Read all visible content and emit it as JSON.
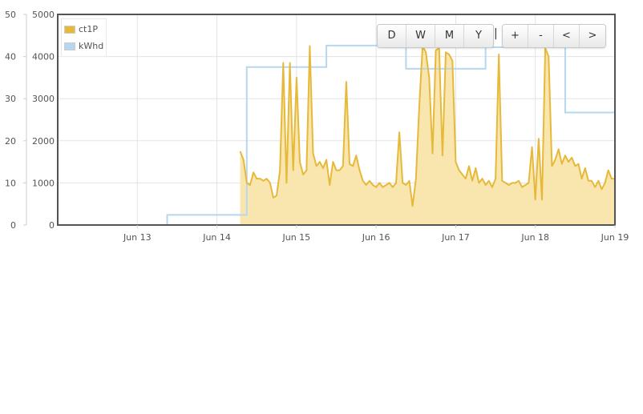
{
  "colors": {
    "ct1p_line": "#e7b93a",
    "ct1p_fill": "#f8e6ae",
    "kwhd_line": "#b5d8f0",
    "frame": "#545454",
    "grid": "#e3e3e3"
  },
  "controls": {
    "range_buttons": [
      "D",
      "W",
      "M",
      "Y"
    ],
    "separator": "|",
    "zoom_buttons": [
      "+",
      "-",
      "<",
      ">"
    ]
  },
  "chart_data": {
    "type": "area",
    "xlim": [
      "2024-06-12T00:00",
      "2024-06-19T00:00"
    ],
    "x_ticks": [
      "Jun 13",
      "Jun 14",
      "Jun 15",
      "Jun 16",
      "Jun 17",
      "Jun 18",
      "Jun 19"
    ],
    "y_left": {
      "ylim": [
        0,
        50
      ],
      "ticks": [
        "0",
        "10",
        "20",
        "30",
        "40",
        "50"
      ]
    },
    "y_right": {
      "ylim": [
        0,
        5000
      ],
      "ticks": [
        "0",
        "1000",
        "2000",
        "3000",
        "4000",
        "5000"
      ]
    },
    "grid": true,
    "legend": "top-left",
    "series": [
      {
        "name": "ct1P",
        "axis": "right",
        "style": "line-fill",
        "points": [
          [
            "2024-06-14T07:00",
            1750
          ],
          [
            "2024-06-14T08:00",
            1550
          ],
          [
            "2024-06-14T09:00",
            1000
          ],
          [
            "2024-06-14T10:00",
            950
          ],
          [
            "2024-06-14T11:00",
            1250
          ],
          [
            "2024-06-14T12:00",
            1100
          ],
          [
            "2024-06-14T13:00",
            1100
          ],
          [
            "2024-06-14T14:00",
            1050
          ],
          [
            "2024-06-14T15:00",
            1100
          ],
          [
            "2024-06-14T16:00",
            1000
          ],
          [
            "2024-06-14T17:00",
            650
          ],
          [
            "2024-06-14T18:00",
            700
          ],
          [
            "2024-06-14T19:00",
            1300
          ],
          [
            "2024-06-14T20:00",
            3850
          ],
          [
            "2024-06-14T21:00",
            1000
          ],
          [
            "2024-06-14T22:00",
            3850
          ],
          [
            "2024-06-14T23:00",
            1300
          ],
          [
            "2024-06-15T00:00",
            3500
          ],
          [
            "2024-06-15T01:00",
            1500
          ],
          [
            "2024-06-15T02:00",
            1200
          ],
          [
            "2024-06-15T03:00",
            1300
          ],
          [
            "2024-06-15T04:00",
            4250
          ],
          [
            "2024-06-15T05:00",
            1700
          ],
          [
            "2024-06-15T06:00",
            1400
          ],
          [
            "2024-06-15T07:00",
            1500
          ],
          [
            "2024-06-15T08:00",
            1350
          ],
          [
            "2024-06-15T09:00",
            1550
          ],
          [
            "2024-06-15T10:00",
            950
          ],
          [
            "2024-06-15T11:00",
            1500
          ],
          [
            "2024-06-15T12:00",
            1300
          ],
          [
            "2024-06-15T13:00",
            1300
          ],
          [
            "2024-06-15T14:00",
            1400
          ],
          [
            "2024-06-15T15:00",
            3400
          ],
          [
            "2024-06-15T16:00",
            1450
          ],
          [
            "2024-06-15T17:00",
            1400
          ],
          [
            "2024-06-15T18:00",
            1650
          ],
          [
            "2024-06-15T19:00",
            1300
          ],
          [
            "2024-06-15T20:00",
            1050
          ],
          [
            "2024-06-15T21:00",
            950
          ],
          [
            "2024-06-15T22:00",
            1050
          ],
          [
            "2024-06-15T23:00",
            950
          ],
          [
            "2024-06-16T00:00",
            900
          ],
          [
            "2024-06-16T01:00",
            1000
          ],
          [
            "2024-06-16T02:00",
            900
          ],
          [
            "2024-06-16T03:00",
            950
          ],
          [
            "2024-06-16T04:00",
            1000
          ],
          [
            "2024-06-16T05:00",
            900
          ],
          [
            "2024-06-16T06:00",
            1000
          ],
          [
            "2024-06-16T07:00",
            2200
          ],
          [
            "2024-06-16T08:00",
            1000
          ],
          [
            "2024-06-16T09:00",
            950
          ],
          [
            "2024-06-16T10:00",
            1050
          ],
          [
            "2024-06-16T11:00",
            450
          ],
          [
            "2024-06-16T12:00",
            1100
          ],
          [
            "2024-06-16T13:00",
            2800
          ],
          [
            "2024-06-16T14:00",
            4250
          ],
          [
            "2024-06-16T15:00",
            4100
          ],
          [
            "2024-06-16T16:00",
            3500
          ],
          [
            "2024-06-16T17:00",
            1700
          ],
          [
            "2024-06-16T18:00",
            4150
          ],
          [
            "2024-06-16T19:00",
            4200
          ],
          [
            "2024-06-16T20:00",
            1650
          ],
          [
            "2024-06-16T21:00",
            4100
          ],
          [
            "2024-06-16T22:00",
            4050
          ],
          [
            "2024-06-16T23:00",
            3900
          ],
          [
            "2024-06-17T00:00",
            1500
          ],
          [
            "2024-06-17T01:00",
            1300
          ],
          [
            "2024-06-17T02:00",
            1200
          ],
          [
            "2024-06-17T03:00",
            1100
          ],
          [
            "2024-06-17T04:00",
            1400
          ],
          [
            "2024-06-17T05:00",
            1050
          ],
          [
            "2024-06-17T06:00",
            1350
          ],
          [
            "2024-06-17T07:00",
            1000
          ],
          [
            "2024-06-17T08:00",
            1100
          ],
          [
            "2024-06-17T09:00",
            950
          ],
          [
            "2024-06-17T10:00",
            1050
          ],
          [
            "2024-06-17T11:00",
            900
          ],
          [
            "2024-06-17T12:00",
            1100
          ],
          [
            "2024-06-17T13:00",
            4050
          ],
          [
            "2024-06-17T14:00",
            1050
          ],
          [
            "2024-06-17T15:00",
            1000
          ],
          [
            "2024-06-17T16:00",
            950
          ],
          [
            "2024-06-17T17:00",
            1000
          ],
          [
            "2024-06-17T18:00",
            1000
          ],
          [
            "2024-06-17T19:00",
            1050
          ],
          [
            "2024-06-17T20:00",
            900
          ],
          [
            "2024-06-17T21:00",
            950
          ],
          [
            "2024-06-17T22:00",
            1000
          ],
          [
            "2024-06-17T23:00",
            1850
          ],
          [
            "2024-06-18T00:00",
            600
          ],
          [
            "2024-06-18T01:00",
            2050
          ],
          [
            "2024-06-18T02:00",
            600
          ],
          [
            "2024-06-18T03:00",
            4200
          ],
          [
            "2024-06-18T04:00",
            4000
          ],
          [
            "2024-06-18T05:00",
            1400
          ],
          [
            "2024-06-18T06:00",
            1550
          ],
          [
            "2024-06-18T07:00",
            1800
          ],
          [
            "2024-06-18T08:00",
            1450
          ],
          [
            "2024-06-18T09:00",
            1650
          ],
          [
            "2024-06-18T10:00",
            1500
          ],
          [
            "2024-06-18T11:00",
            1600
          ],
          [
            "2024-06-18T12:00",
            1400
          ],
          [
            "2024-06-18T13:00",
            1450
          ],
          [
            "2024-06-18T14:00",
            1100
          ],
          [
            "2024-06-18T15:00",
            1350
          ],
          [
            "2024-06-18T16:00",
            1050
          ],
          [
            "2024-06-18T17:00",
            1050
          ],
          [
            "2024-06-18T18:00",
            900
          ],
          [
            "2024-06-18T19:00",
            1050
          ],
          [
            "2024-06-18T20:00",
            850
          ],
          [
            "2024-06-18T21:00",
            1000
          ],
          [
            "2024-06-18T22:00",
            1300
          ],
          [
            "2024-06-18T23:00",
            1100
          ]
        ]
      },
      {
        "name": "kWhd",
        "axis": "left",
        "style": "steps",
        "points": [
          [
            "2024-06-12T00:00",
            0
          ],
          [
            "2024-06-13T09:00",
            2.4
          ],
          [
            "2024-06-14T09:00",
            37.5
          ],
          [
            "2024-06-15T09:00",
            42.6
          ],
          [
            "2024-06-16T09:00",
            37.1
          ],
          [
            "2024-06-17T09:00",
            42.2
          ],
          [
            "2024-06-18T09:00",
            26.7
          ],
          [
            "2024-06-19T00:00",
            26.7
          ]
        ]
      }
    ]
  }
}
